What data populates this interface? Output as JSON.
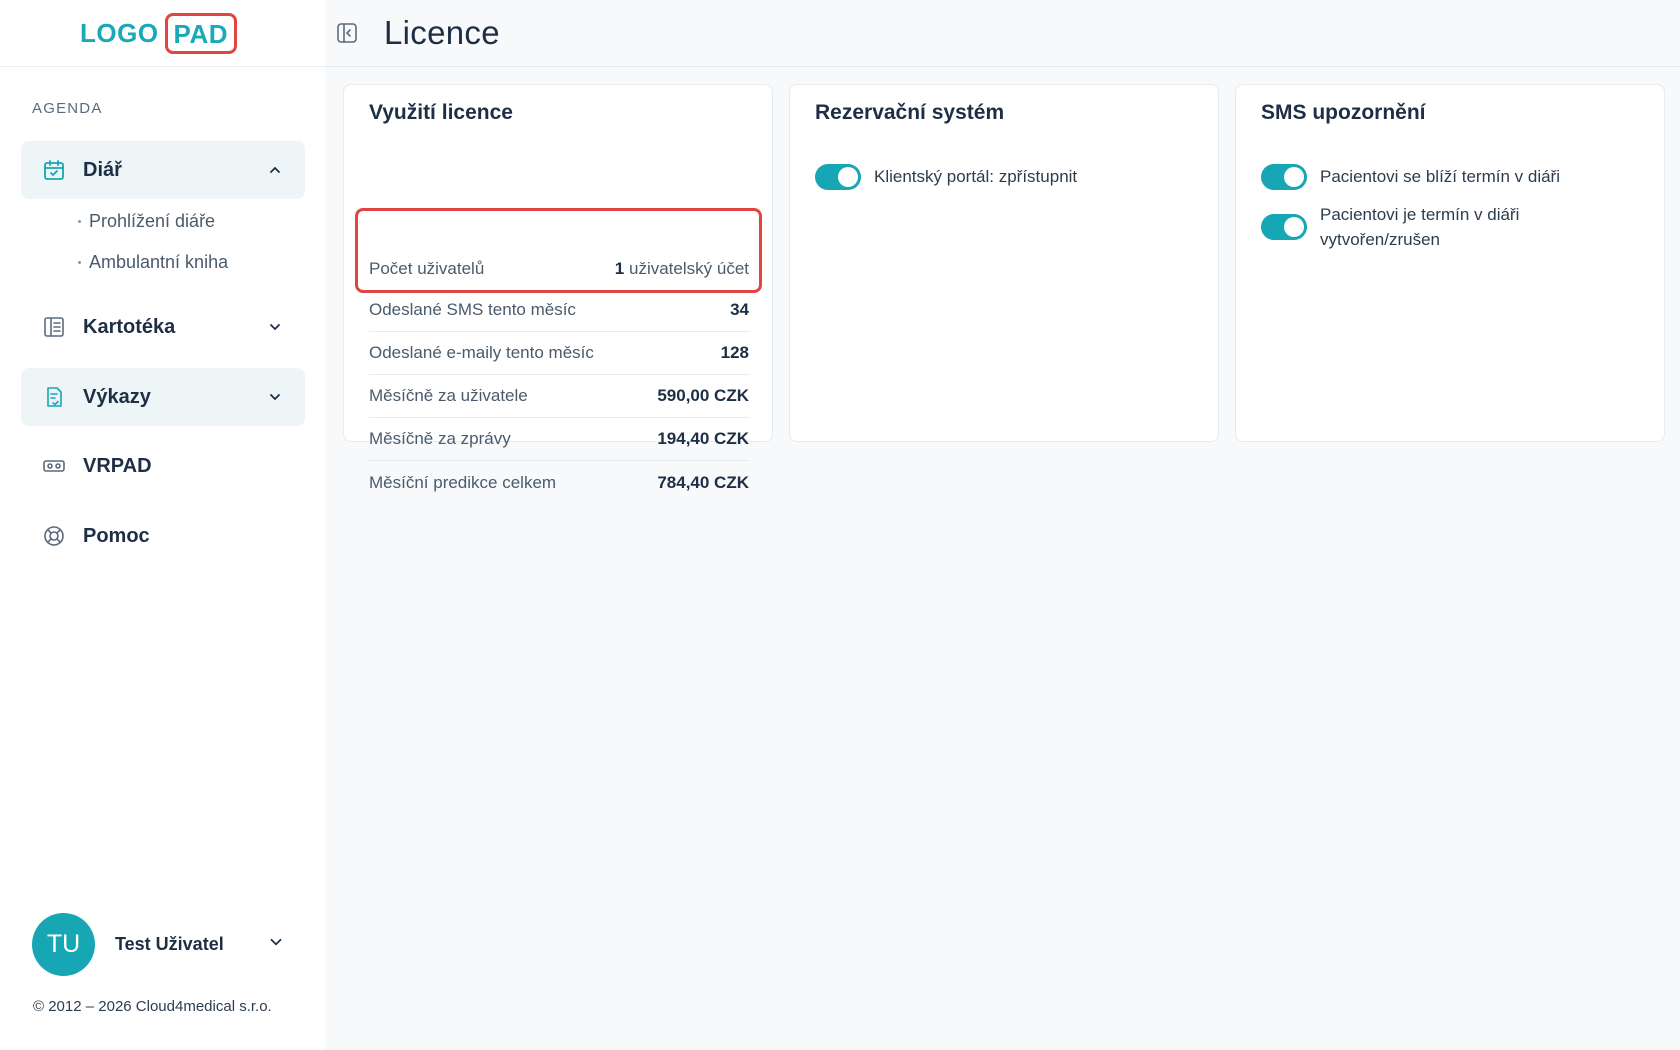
{
  "logo": {
    "part1": "LOGO",
    "part2": "PAD"
  },
  "sidebar": {
    "section_label": "AGENDA",
    "items": [
      {
        "label": "Diář",
        "icon": "calendar-check-icon",
        "expanded": true,
        "subitems": [
          "Prohlížení diáře",
          "Ambulantní kniha"
        ]
      },
      {
        "label": "Kartotéka",
        "icon": "card-file-icon",
        "expanded": false
      },
      {
        "label": "Výkazy",
        "icon": "report-icon",
        "expanded": false
      },
      {
        "label": "VRPAD",
        "icon": "vr-headset-icon"
      },
      {
        "label": "Pomoc",
        "icon": "lifebuoy-icon"
      }
    ],
    "user": {
      "initials": "TU",
      "name": "Test Uživatel"
    },
    "copyright": "© 2012 – 2026 Cloud4medical s.r.o."
  },
  "header": {
    "title": "Licence"
  },
  "cards": {
    "license": {
      "title": "Využití licence",
      "rows": [
        {
          "key": "Počet uživatelů",
          "value": "1",
          "unit": "uživatelský účet"
        },
        {
          "key": "Odeslané SMS tento měsíc",
          "value": "34"
        },
        {
          "key": "Odeslané e-maily tento měsíc",
          "value": "128"
        },
        {
          "key": "Měsíčně za uživatele",
          "value": "590,00 CZK"
        },
        {
          "key": "Měsíčně za zprávy",
          "value": "194,40 CZK"
        },
        {
          "key": "Měsíční predikce celkem",
          "value": "784,40 CZK"
        }
      ]
    },
    "reservation": {
      "title": "Rezervační systém",
      "toggles": [
        {
          "label": "Klientský portál: zpřístupnit",
          "on": true
        }
      ]
    },
    "sms": {
      "title": "SMS upozornění",
      "toggles": [
        {
          "label": "Pacientovi se blíží termín v diáři",
          "on": true
        },
        {
          "label": "Pacientovi je termín v diáři vytvořen/zrušen",
          "on": true
        }
      ]
    }
  },
  "colors": {
    "accent": "#17a6b4",
    "highlight": "#e0463f",
    "text": "#1e2f45"
  }
}
